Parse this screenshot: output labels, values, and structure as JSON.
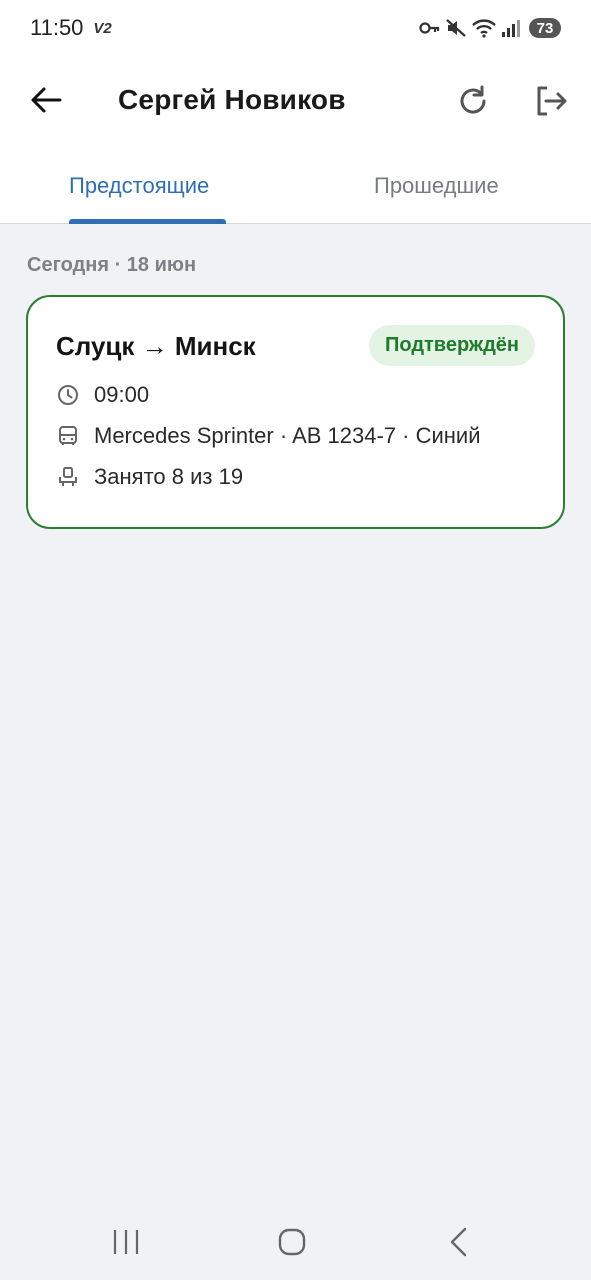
{
  "status_bar": {
    "time": "11:50",
    "network_label": "V2",
    "battery": "73",
    "icons": [
      "key-icon",
      "mute-icon",
      "wifi-icon",
      "signal-icon",
      "battery-icon"
    ]
  },
  "app_bar": {
    "title": "Сергей Новиков",
    "icons": {
      "back": "arrow-left-icon",
      "refresh": "refresh-icon",
      "logout": "logout-icon"
    }
  },
  "tabs": [
    {
      "label": "Предстоящие",
      "active": true
    },
    {
      "label": "Прошедшие",
      "active": false
    }
  ],
  "section": {
    "date_label": "Сегодня · 18 июн"
  },
  "trips": [
    {
      "route": "Слуцк → Минск",
      "status": "Подтверждён",
      "time": "09:00",
      "vehicle": "Mercedes Sprinter · AB 1234-7 · Синий",
      "seats": "Занято 8 из 19"
    }
  ],
  "colors": {
    "accent": "#2f6db5",
    "status_border": "#2e7d32",
    "status_text": "#1f7a2c",
    "status_bg": "#e3f3e4",
    "background": "#f0f2f5"
  },
  "system_nav": {
    "icons": [
      "recent-apps-icon",
      "home-icon",
      "back-icon"
    ]
  }
}
